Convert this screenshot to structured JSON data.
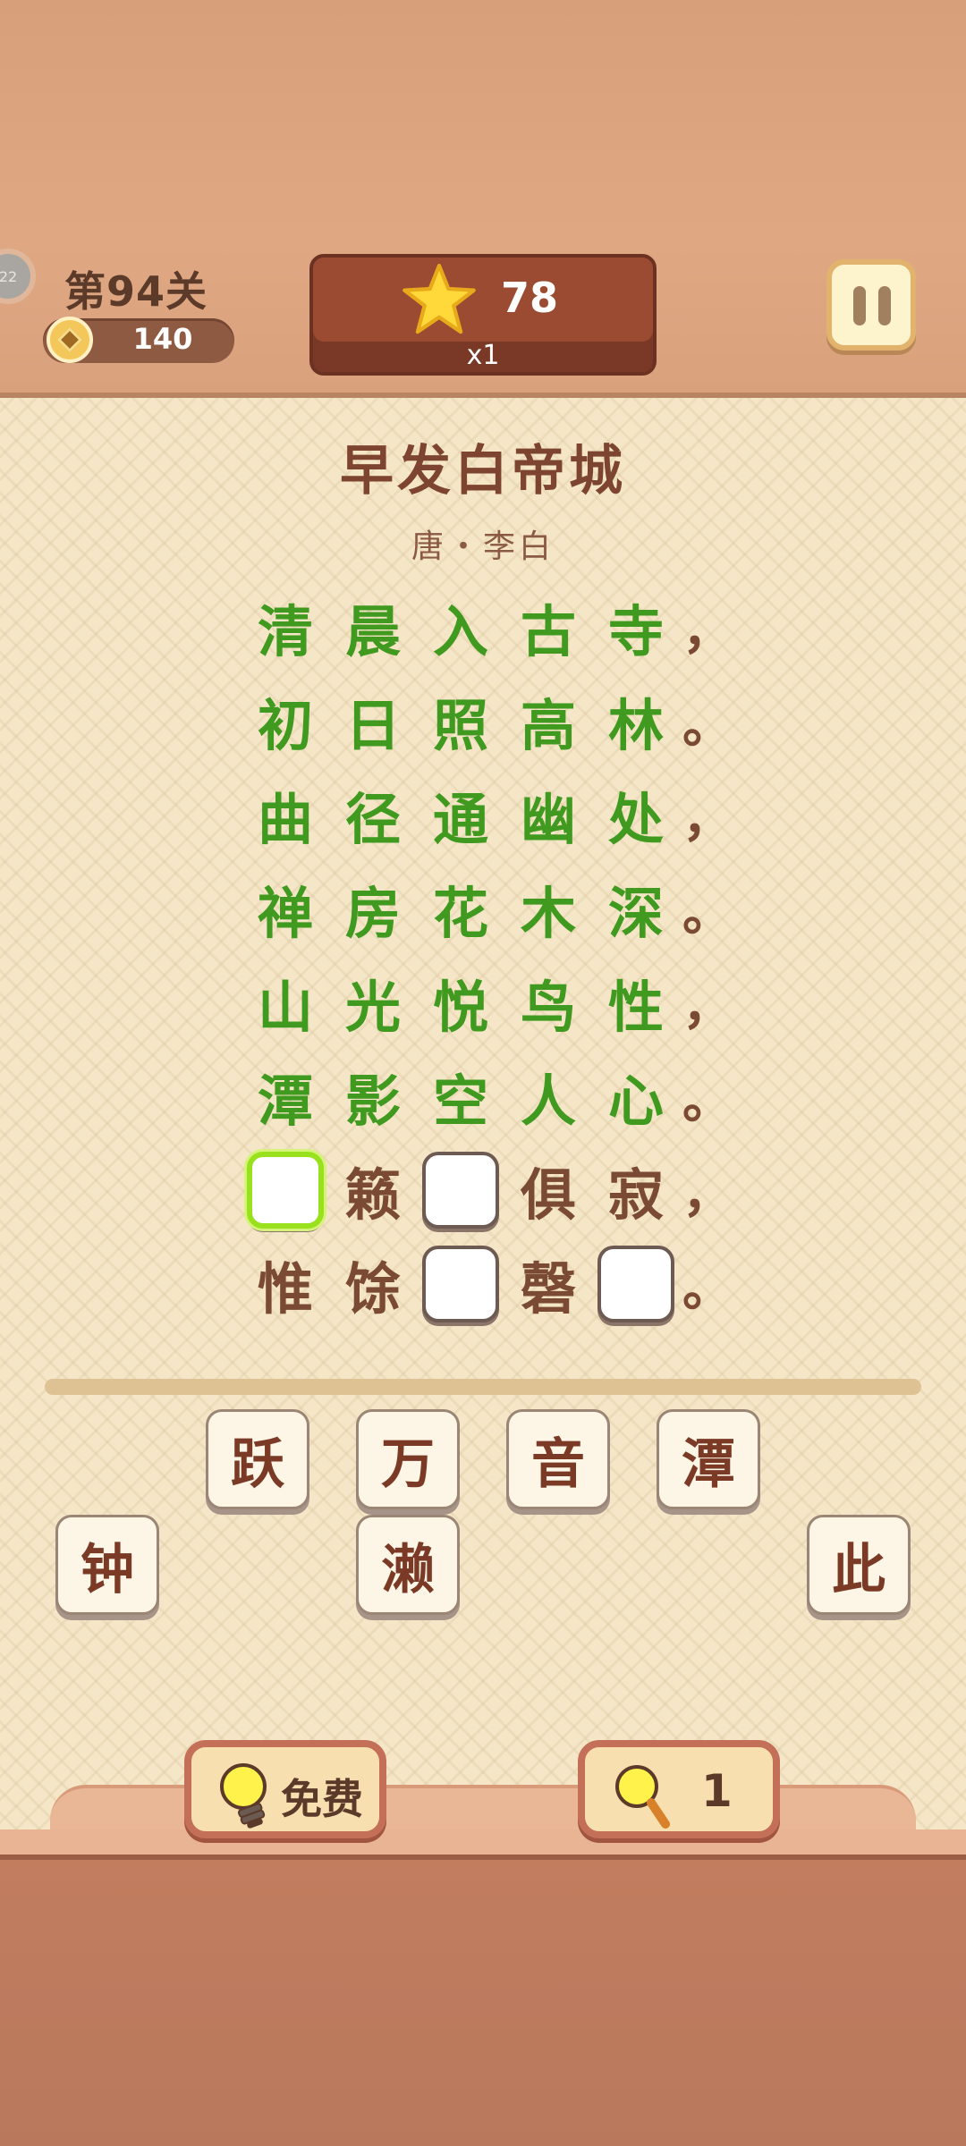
{
  "header": {
    "avatar_text": "22",
    "level_label": "第94关",
    "coins": "140",
    "score": "78",
    "multiplier": "x1"
  },
  "poem": {
    "title": "早发白帝城",
    "author": "唐・李白",
    "lines": [
      [
        "清",
        "晨",
        "入",
        "古",
        "寺",
        "，"
      ],
      [
        "初",
        "日",
        "照",
        "高",
        "林",
        "。"
      ],
      [
        "曲",
        "径",
        "通",
        "幽",
        "处",
        "，"
      ],
      [
        "禅",
        "房",
        "花",
        "木",
        "深",
        "。"
      ],
      [
        "山",
        "光",
        "悦",
        "鸟",
        "性",
        "，"
      ],
      [
        "潭",
        "影",
        "空",
        "人",
        "心",
        "。"
      ],
      [
        "",
        "籁",
        "",
        "俱",
        "寂",
        "，"
      ],
      [
        "惟",
        "馀",
        "",
        "磬",
        "",
        "。"
      ]
    ],
    "line_states": [
      [
        "done",
        "done",
        "done",
        "done",
        "done",
        "punct"
      ],
      [
        "done",
        "done",
        "done",
        "done",
        "done",
        "punct"
      ],
      [
        "done",
        "done",
        "done",
        "done",
        "done",
        "punct"
      ],
      [
        "done",
        "done",
        "done",
        "done",
        "done",
        "punct"
      ],
      [
        "done",
        "done",
        "done",
        "done",
        "done",
        "punct"
      ],
      [
        "done",
        "done",
        "done",
        "done",
        "done",
        "punct"
      ],
      [
        "blank-active",
        "given",
        "blank",
        "given",
        "given",
        "punct"
      ],
      [
        "given",
        "given",
        "blank",
        "given",
        "blank",
        "punct"
      ]
    ]
  },
  "tiles": [
    "跃",
    "万",
    "音",
    "潭",
    "钟",
    "濑",
    "此"
  ],
  "actions": {
    "hint_label": "免费",
    "magnify_count": "1"
  },
  "colors": {
    "solved_text": "#3f9a1f",
    "given_text": "#7a4a34",
    "active_blank_border": "#9ae11d"
  }
}
